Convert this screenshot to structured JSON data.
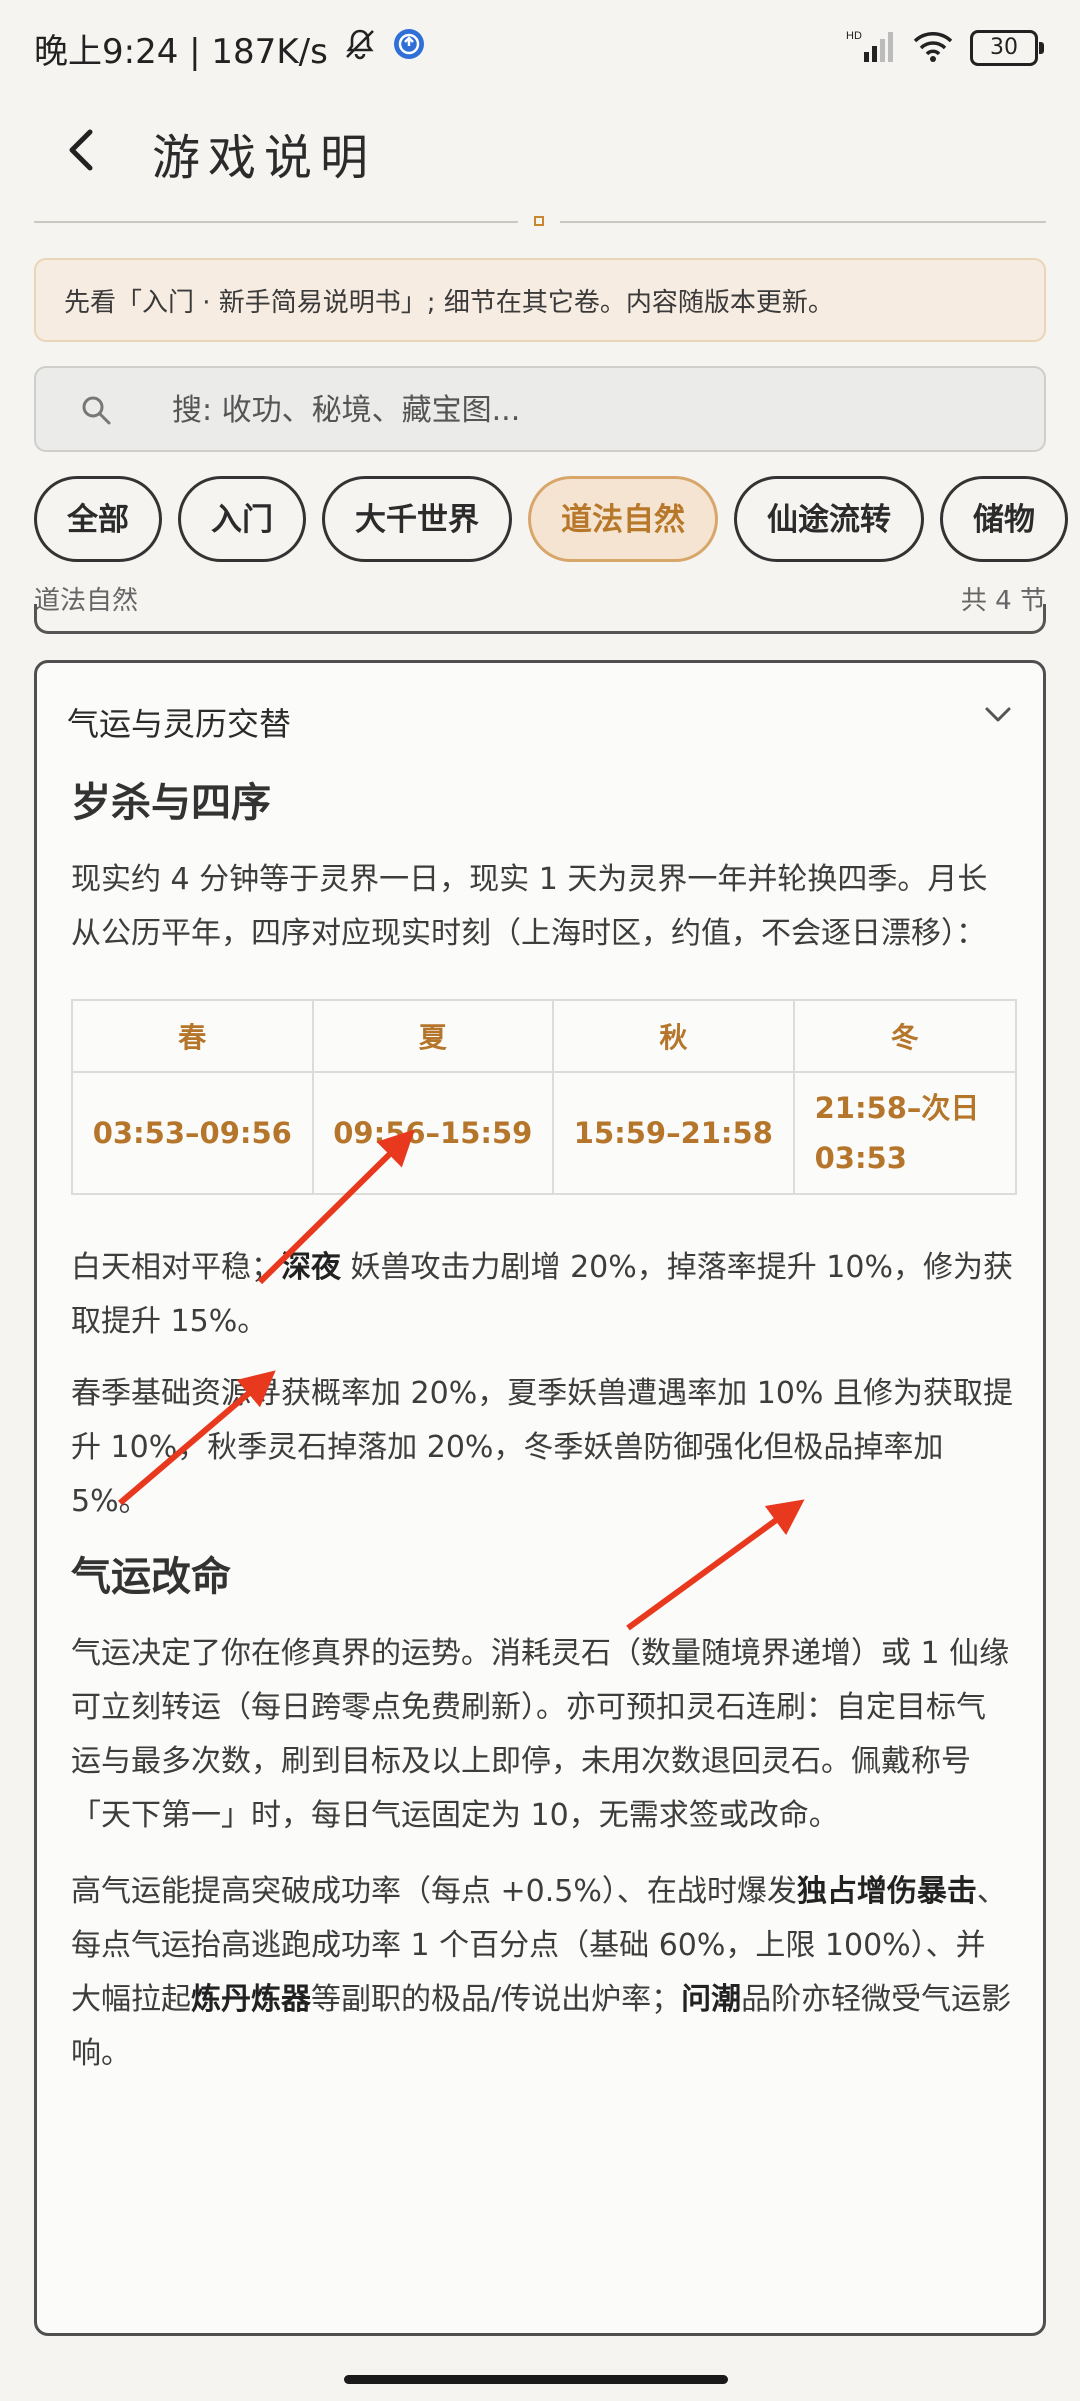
{
  "status": {
    "time_text": "晚上9:24 | 187K/s",
    "battery": "30",
    "network": "HD"
  },
  "header": {
    "title": "游戏说明"
  },
  "notice": "先看「入门 · 新手简易说明书」; 细节在其它卷。内容随版本更新。",
  "search": {
    "placeholder": "搜: 收功、秘境、藏宝图..."
  },
  "tabs": [
    {
      "label": "全部",
      "active": false
    },
    {
      "label": "入门",
      "active": false
    },
    {
      "label": "大千世界",
      "active": false
    },
    {
      "label": "道法自然",
      "active": true
    },
    {
      "label": "仙途流转",
      "active": false
    },
    {
      "label": "储物",
      "active": false
    }
  ],
  "section": {
    "label": "道法自然",
    "count": "共 4 节"
  },
  "card": {
    "title": "气运与灵历交替",
    "h_season": "岁杀与四序",
    "p_intro": "现实约 4 分钟等于灵界一日，现实 1 天为灵界一年并轮换四季。月长从公历平年，四序对应现实时刻（上海时区，约值，不会逐日漂移）：",
    "table": {
      "headers": [
        "春",
        "夏",
        "秋",
        "冬"
      ],
      "cells": [
        "03:53–09:56",
        "09:56–15:59",
        "15:59–21:58",
        "21:58–次日",
        "03:53"
      ]
    },
    "p_day_a": "白天相对平稳；",
    "p_day_bold": "深夜",
    "p_day_b": " 妖兽攻击力剧增 20%，掉落率提升 10%，修为获取提升 15%。",
    "p_seasons": "春季基础资源寻获概率加 20%，夏季妖兽遭遇率加 10% 且修为获取提升 10%，秋季灵石掉落加 20%，冬季妖兽防御强化但极品掉率加 5%。",
    "h_luck": "气运改命",
    "p_luck1": "气运决定了你在修真界的运势。消耗灵石（数量随境界递增）或 1 仙缘可立刻转运（每日跨零点免费刷新）。亦可预扣灵石连刷：自定目标气运与最多次数，刷到目标及以上即停，未用次数退回灵石。佩戴称号「天下第一」时，每日气运固定为 10，无需求签或改命。",
    "p_luck2_a": "高气运能提高突破成功率（每点 +0.5%）、在战时爆发",
    "p_luck2_b1": "独占增伤暴击",
    "p_luck2_c": "、每点气运抬高逃跑成功率 1 个百分点（基础 60%，上限 100%）、并大幅拉起",
    "p_luck2_b2": "炼丹炼器",
    "p_luck2_d": "等副职的极品/传说出炉率；",
    "p_luck2_b3": "问潮",
    "p_luck2_e": "品阶亦轻微受气运影响。"
  },
  "colors": {
    "accent": "#b5762c",
    "arrow": "#e8391f",
    "background": "#f5f4f1"
  }
}
